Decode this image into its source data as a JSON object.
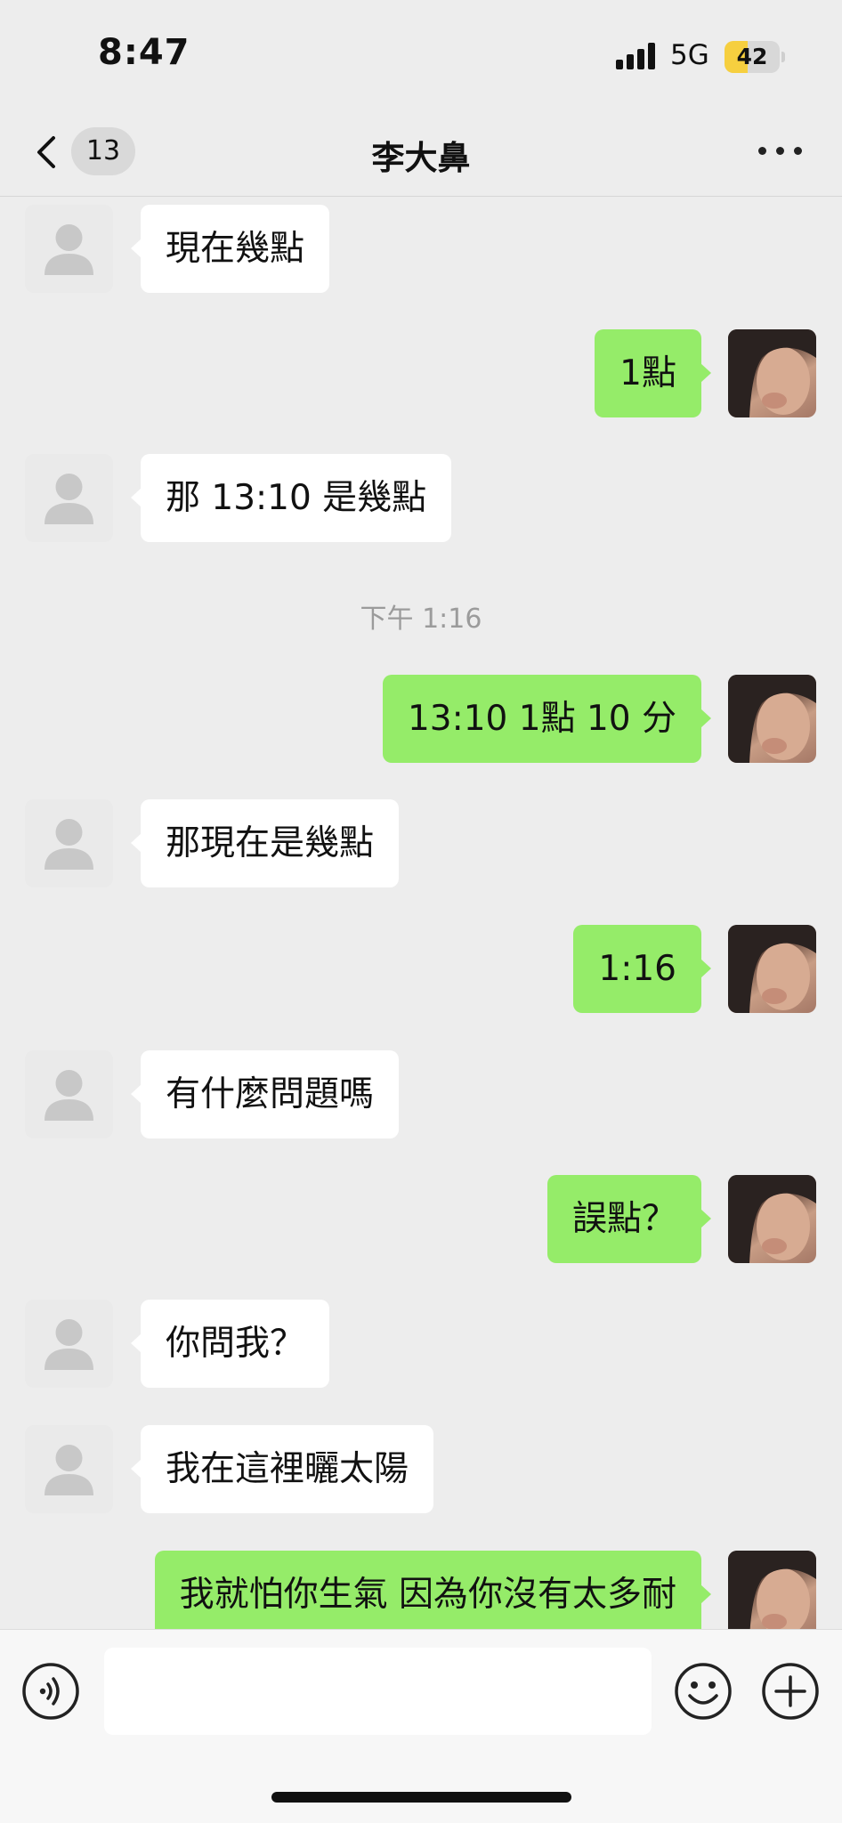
{
  "status_bar": {
    "time": "8:47",
    "network": "5G",
    "battery_level": "42",
    "battery_fraction": 0.42,
    "battery_color": "#f6cf3f"
  },
  "nav": {
    "unread_count": "13",
    "title": "李大鼻",
    "back_icon": "chevron-left-icon",
    "more_icon": "more-dots-icon"
  },
  "messages": [
    {
      "from": "other",
      "text": "現在幾點"
    },
    {
      "from": "me",
      "text": "1點"
    },
    {
      "from": "other",
      "text": "那 13:10 是幾點"
    },
    {
      "type": "time",
      "text": "下午 1:16"
    },
    {
      "from": "me",
      "text": "13:10 1點 10 分"
    },
    {
      "from": "other",
      "text": "那現在是幾點"
    },
    {
      "from": "me",
      "text": "1:16"
    },
    {
      "from": "other",
      "text": "有什麼問題嗎"
    },
    {
      "from": "me",
      "text": "誤點？"
    },
    {
      "from": "other",
      "text": "你問我？"
    },
    {
      "from": "other",
      "text": "我在這裡曬太陽"
    },
    {
      "from": "me",
      "text": "我就怕你生氣 因為你沒有太多耐"
    }
  ],
  "input_bar": {
    "voice_icon": "voice-icon",
    "emoji_icon": "emoji-icon",
    "plus_icon": "plus-icon",
    "input_value": ""
  },
  "colors": {
    "outgoing_bubble": "#95ec69",
    "incoming_bubble": "#ffffff",
    "background": "#ededed"
  }
}
